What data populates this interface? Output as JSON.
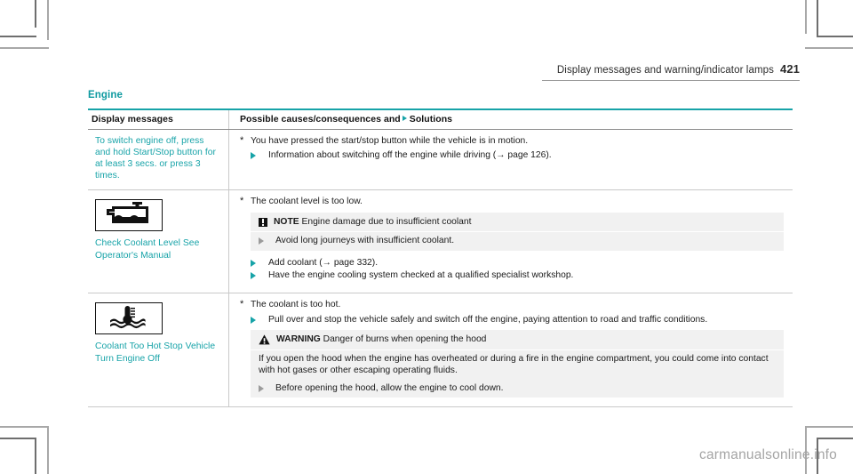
{
  "header": {
    "title": "Display messages and warning/indicator lamps",
    "page_number": "421"
  },
  "section": {
    "title": "Engine"
  },
  "table": {
    "columns": {
      "left": "Display messages",
      "right_before_icon": "Possible causes/consequences and",
      "right_after_icon": "Solutions"
    },
    "rows": [
      {
        "display_message": "To switch engine off, press and hold Start/Stop button for at least 3 secs. or press 3 times.",
        "cause": "You have pressed the start/stop button while the vehicle is in motion.",
        "solutions": [
          "Information about switching off the engine while driving (→ page 126)."
        ]
      },
      {
        "icon_name": "coolant-level-low-icon",
        "display_message": "Check Coolant Level See Operator's Manual",
        "cause": "The coolant level is too low.",
        "note": {
          "label": "NOTE",
          "title": "Engine damage due to insufficient coolant",
          "action": "Avoid long journeys with insufficient coolant."
        },
        "solutions": [
          "Add coolant (→ page 332).",
          "Have the engine cooling system checked at a qualified specialist workshop."
        ]
      },
      {
        "icon_name": "coolant-temperature-high-icon",
        "display_message": "Coolant Too Hot Stop Vehicle Turn Engine Off",
        "cause": "The coolant is too hot.",
        "solutions": [
          "Pull over and stop the vehicle safely and switch off the engine, paying attention to road and traffic conditions."
        ],
        "warning": {
          "label": "WARNING",
          "title": "Danger of burns when opening the hood",
          "body": "If you open the hood when the engine has overheated or during a fire in the engine compartment, you could come into contact with hot gases or other escaping operating fluids.",
          "action": "Before opening the hood, allow the engine to cool down."
        }
      }
    ]
  },
  "watermark": "carmanualsonline.info",
  "colors": {
    "accent_teal": "#17a3a8",
    "rule_gray": "#c9c9c9",
    "box_gray": "#f1f1f1"
  }
}
